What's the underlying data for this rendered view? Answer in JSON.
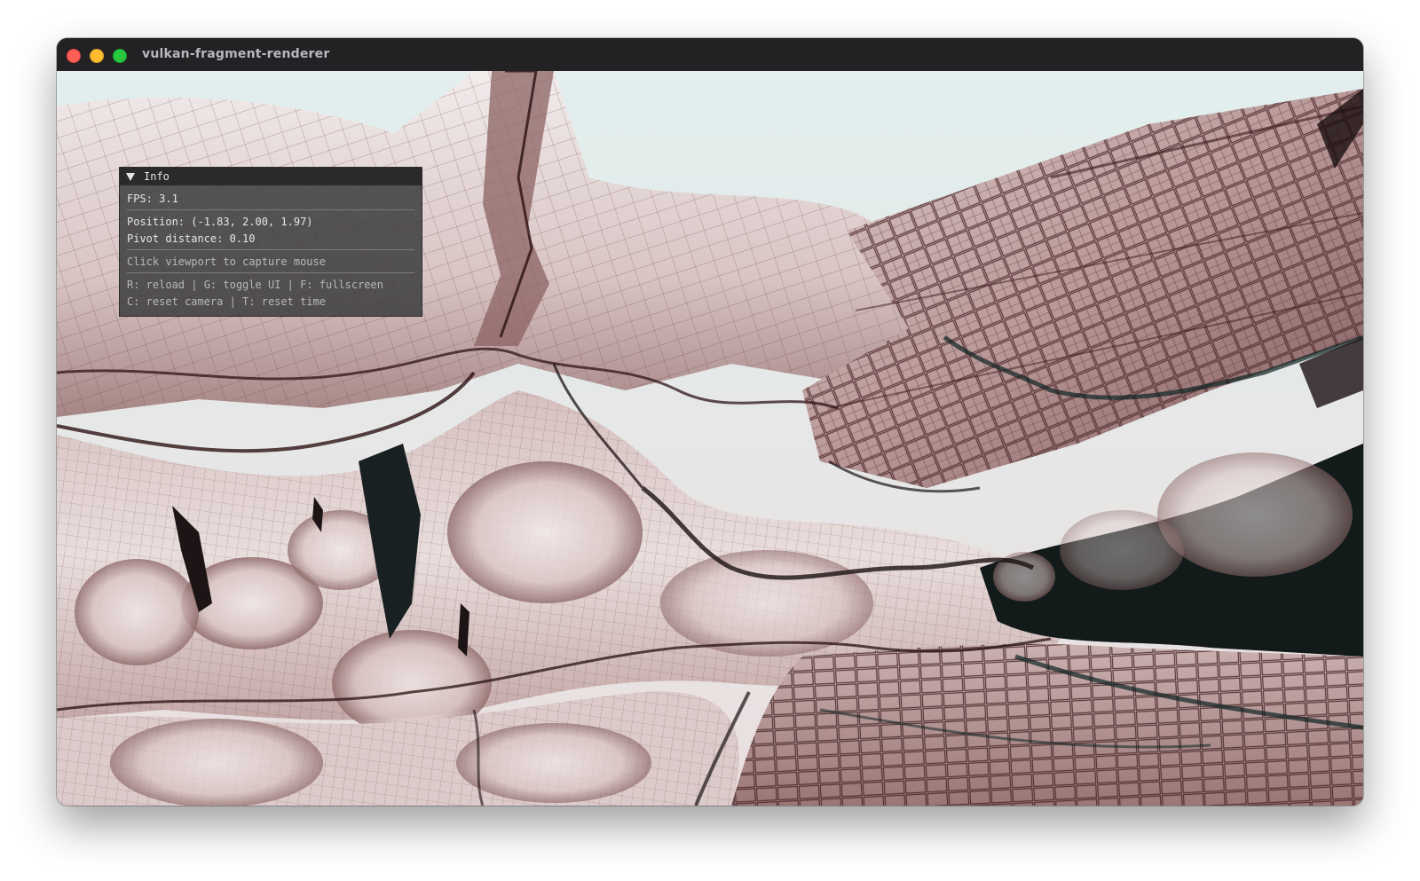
{
  "window": {
    "title": "vulkan-fragment-renderer"
  },
  "info_panel": {
    "header": "Info",
    "fps": "FPS: 3.1",
    "position": "Position: (-1.83, 2.00, 1.97)",
    "pivot_distance": "Pivot distance: 0.10",
    "hint_capture": "Click viewport to capture mouse",
    "shortcuts_line1": "R: reload | G: toggle UI | F: fullscreen",
    "shortcuts_line2": "C: reset camera | T: reset time"
  },
  "colors": {
    "titlebar": "#222225",
    "close": "#ff5f57",
    "minimize": "#febc2e",
    "maximize": "#28c840",
    "render_light": "#e8dedc",
    "render_mid": "#b08d8b",
    "render_dark": "#3a1d1f",
    "render_shadow": "#0e2423",
    "sky": "#dceceb"
  },
  "icons": {
    "collapse": "triangle-down-icon"
  }
}
